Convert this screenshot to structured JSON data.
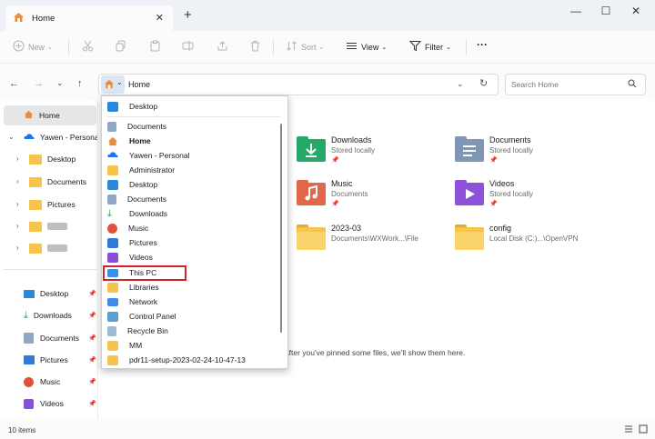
{
  "window": {
    "tab_title": "Home",
    "new_tab": "+",
    "tab_close": "✕",
    "minimize": "—",
    "maximize": "☐",
    "close": "✕"
  },
  "toolbar": {
    "new_label": "New",
    "sort_label": "Sort",
    "view_label": "View",
    "filter_label": "Filter",
    "more_label": "···"
  },
  "address": {
    "path": "Home",
    "search_placeholder": "Search Home"
  },
  "sidebar": {
    "items": [
      {
        "label": "Home"
      },
      {
        "label": "Yawen - Personal"
      },
      {
        "label": "Desktop"
      },
      {
        "label": "Documents"
      },
      {
        "label": "Pictures"
      },
      {
        "label": ""
      },
      {
        "label": ""
      },
      {
        "label": "Desktop"
      },
      {
        "label": "Downloads"
      },
      {
        "label": "Documents"
      },
      {
        "label": "Pictures"
      },
      {
        "label": "Music"
      },
      {
        "label": "Videos"
      }
    ]
  },
  "content": {
    "items": [
      {
        "name": "Downloads",
        "sub": "Stored locally"
      },
      {
        "name": "Documents",
        "sub": "Stored locally"
      },
      {
        "name": "Music",
        "sub": "Documents"
      },
      {
        "name": "Videos",
        "sub": "Stored locally"
      },
      {
        "name": "2023-03",
        "sub": "Documents\\WXWork...\\File"
      },
      {
        "name": "config",
        "sub": "Local Disk (C:)...\\OpenVPN"
      }
    ],
    "pinned_hint": "After you've pinned some files, we'll show them here."
  },
  "dropdown": {
    "items": [
      {
        "label": "Desktop",
        "icon": "desktop-icon",
        "color": "#2b88d8"
      },
      {
        "label": "Documents",
        "icon": "documents-icon",
        "color": "#8fa7c4"
      },
      {
        "label": "Home",
        "icon": "home-icon",
        "color": "#e98b3a"
      },
      {
        "label": "Yawen - Personal",
        "icon": "onedrive-icon",
        "color": "#1a73e8"
      },
      {
        "label": "Administrator",
        "icon": "user-folder-icon",
        "color": "#f6c34c"
      },
      {
        "label": "Desktop",
        "icon": "desktop-icon",
        "color": "#2b88d8"
      },
      {
        "label": "Documents",
        "icon": "documents-icon",
        "color": "#8fa7c4"
      },
      {
        "label": "Downloads",
        "icon": "downloads-icon",
        "color": "#1ea362"
      },
      {
        "label": "Music",
        "icon": "music-icon",
        "color": "#e0533b"
      },
      {
        "label": "Pictures",
        "icon": "pictures-icon",
        "color": "#2f7ad8"
      },
      {
        "label": "Videos",
        "icon": "videos-icon",
        "color": "#8a4fd8"
      },
      {
        "label": "This PC",
        "icon": "this-pc-icon",
        "color": "#3a8ee6"
      },
      {
        "label": "Libraries",
        "icon": "libraries-icon",
        "color": "#f6c34c"
      },
      {
        "label": "Network",
        "icon": "network-icon",
        "color": "#3a8ee6"
      },
      {
        "label": "Control Panel",
        "icon": "control-panel-icon",
        "color": "#5aa0d8"
      },
      {
        "label": "Recycle Bin",
        "icon": "recycle-bin-icon",
        "color": "#9bbad6"
      },
      {
        "label": "MM",
        "icon": "folder-icon",
        "color": "#f6c34c"
      },
      {
        "label": "pdr11-setup-2023-02-24-10-47-13",
        "icon": "folder-icon",
        "color": "#f6c34c"
      }
    ]
  },
  "status": {
    "count": "10 items"
  }
}
